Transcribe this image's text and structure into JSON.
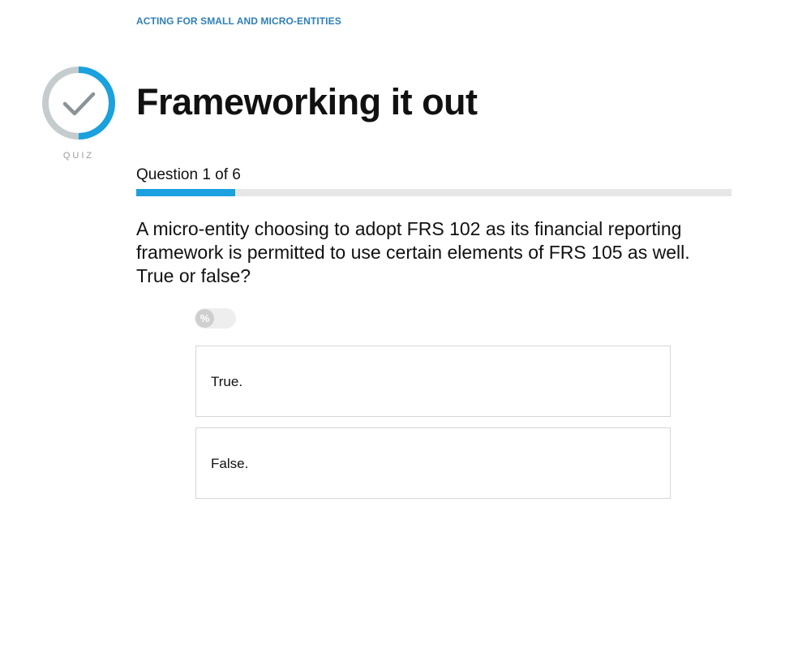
{
  "breadcrumb": "ACTING FOR SMALL AND MICRO-ENTITIES",
  "quiz_icon": {
    "icon": "checkmark-icon",
    "label": "QUIZ",
    "ring_color": "#c5cccd",
    "accent_color": "#1aa1de",
    "check_color": "#8a9396"
  },
  "page_title": "Frameworking it out",
  "progress": {
    "counter_text": "Question 1 of 6",
    "current": 1,
    "total": 6,
    "fill_color": "#1aa1de",
    "track_color": "#e6e6e6"
  },
  "question": {
    "text": "A micro-entity choosing to adopt FRS 102 as its financial reporting framework is permitted to use certain elements of FRS 105 as well. True or false?"
  },
  "percent_toggle": {
    "symbol": "%",
    "enabled": false
  },
  "answers": [
    {
      "label": "True."
    },
    {
      "label": "False."
    }
  ]
}
